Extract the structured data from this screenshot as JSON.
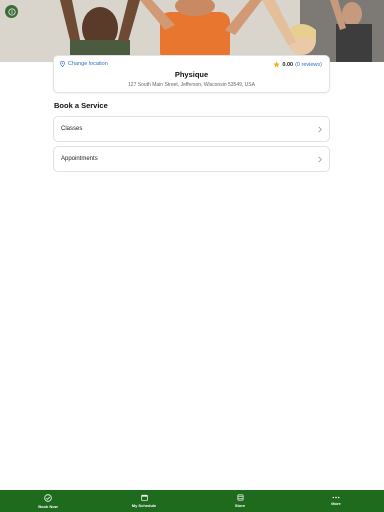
{
  "location": {
    "change_label": "Change location",
    "rating_score": "0.00",
    "rating_reviews": "(0 reviews)",
    "studio_name": "Physique",
    "address": "127 South Main Street, Jefferson, Wisconsin 53549, USA"
  },
  "section_title": "Book a Service",
  "services": [
    {
      "label": "Classes"
    },
    {
      "label": "Appointments"
    }
  ],
  "bottom_nav": [
    {
      "label": "Book Now",
      "icon": "check-circle-icon"
    },
    {
      "label": "My Schedule",
      "icon": "calendar-icon"
    },
    {
      "label": "Store",
      "icon": "store-icon"
    },
    {
      "label": "More",
      "icon": "more-dots-icon"
    }
  ],
  "colors": {
    "nav_bg": "#1e6b1e",
    "link": "#2f6cc9",
    "star": "#f2b01e",
    "info_btn": "#3d6b3a"
  }
}
